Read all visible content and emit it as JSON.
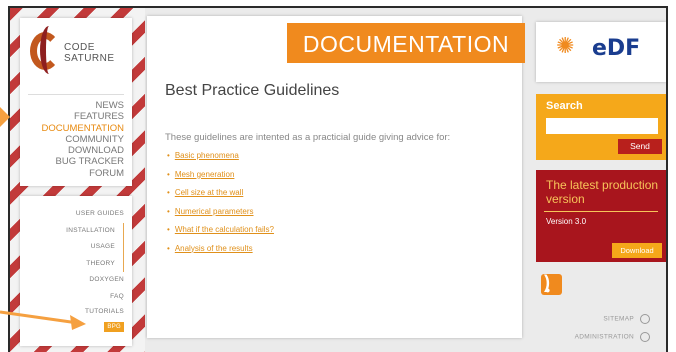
{
  "logo": {
    "line1": "CODE",
    "line2": "SATURNE"
  },
  "nav": {
    "items": [
      "NEWS",
      "FEATURES",
      "DOCUMENTATION",
      "COMMUNITY",
      "DOWNLOAD",
      "BUG TRACKER",
      "FORUM"
    ],
    "active_index": 2
  },
  "subnav": {
    "items": [
      "USER GUIDES",
      "INSTALLATION",
      "USAGE",
      "THEORY",
      "DOXYGEN",
      "FAQ",
      "TUTORIALS"
    ],
    "highlight": "BPG"
  },
  "banner": {
    "title": "DOCUMENTATION"
  },
  "main": {
    "heading": "Best Practice Guidelines",
    "intro": "These guidelines are intented as a practicial guide giving advice for:",
    "links": [
      "Basic phenomena",
      "Mesh generation",
      "Cell size at the wall",
      "Numerical parameters",
      "What if the calculation fails?",
      "Analysis of the results"
    ]
  },
  "partner": {
    "name": "eDF"
  },
  "search": {
    "label": "Search",
    "value": "",
    "button": "Send"
  },
  "release": {
    "title": "The latest production version",
    "version": "Version 3.0",
    "download": "Download"
  },
  "footer": {
    "sitemap": "SITEMAP",
    "admin": "ADMINISTRATION"
  },
  "colors": {
    "accent": "#f08a1e",
    "dark_red": "#a8151d",
    "search_bg": "#f5a81a"
  }
}
